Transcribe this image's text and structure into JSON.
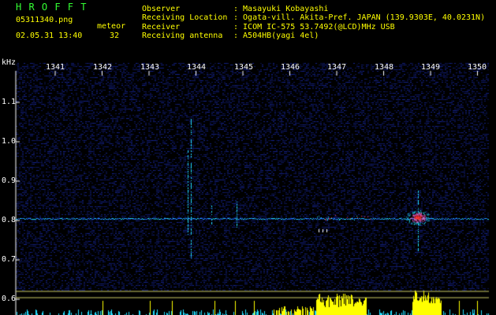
{
  "header": {
    "title": "H R O F F T",
    "filename": "05311340.png",
    "meteor_label": "meteor",
    "datetime": "02.05.31 13:40",
    "meteor_count": "32",
    "observer_label": "Observer",
    "observer_value": ": Masayuki Kobayashi",
    "location_label": "Receiving Location",
    "location_value": ": Ogata-vill. Akita-Pref. JAPAN (139.9303E, 40.0231N)",
    "receiver_label": "Receiver",
    "receiver_value": ": ICOM IC-575 53.7492(@LCD)MHz USB",
    "antenna_label": "Receiving antenna",
    "antenna_value": ": A504HB(yagi 4el)"
  },
  "axis": {
    "unit": "kHz",
    "freq_ticks": [
      "1.1",
      "1.0",
      "0.9",
      "0.8",
      "0.7",
      "0.6"
    ],
    "minute_ticks": [
      "1341",
      "1342",
      "1343",
      "1344",
      "1345",
      "1346",
      "1347",
      "1348",
      "1349",
      "1350"
    ]
  },
  "colors": {
    "background": "#000000",
    "noise": "#1a2a8a",
    "signal": "#22ddff",
    "hot": "#ff3333",
    "peak": "#ffff00",
    "bars": "#22ddff",
    "header_title": "#33ff33",
    "header_text": "#ffff00"
  }
}
